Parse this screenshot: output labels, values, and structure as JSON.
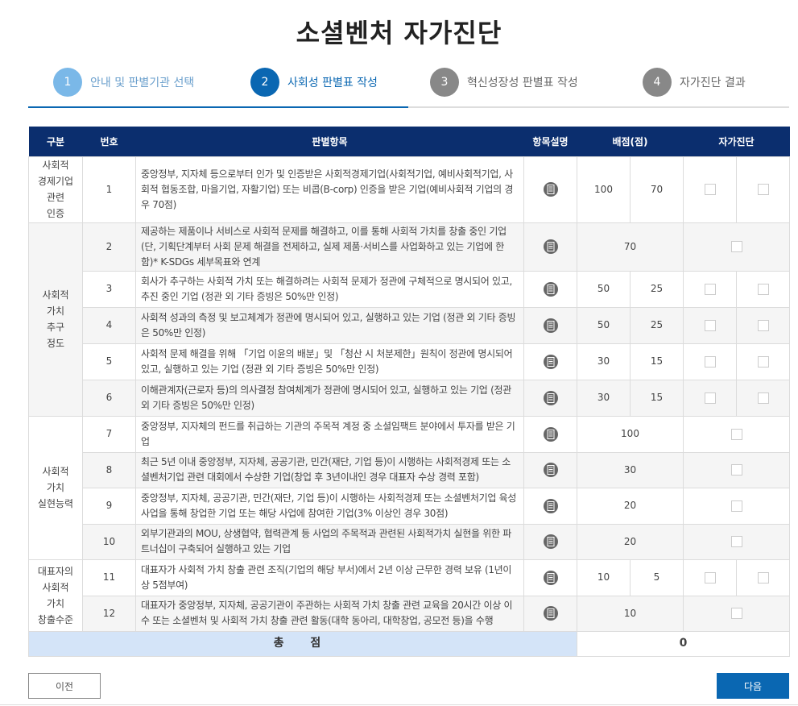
{
  "page": {
    "title": "소셜벤처 자가진단"
  },
  "steps": [
    {
      "num": "1",
      "label": "안내 및 판별기관 선택",
      "state": "done"
    },
    {
      "num": "2",
      "label": "사회성 판별표 작성",
      "state": "active"
    },
    {
      "num": "3",
      "label": "혁신성장성 판별표 작성",
      "state": "todo"
    },
    {
      "num": "4",
      "label": "자가진단 결과",
      "state": "todo"
    }
  ],
  "table": {
    "headers": {
      "category": "구분",
      "number": "번호",
      "item": "판별항목",
      "desc": "항목설명",
      "score": "배점(점)",
      "self": "자가진단"
    },
    "categories": {
      "c1": "사회적\n경제기업\n관련\n인증",
      "c2": "사회적\n가치\n추구\n정도",
      "c3": "사회적\n가치\n실현능력",
      "c4": "대표자의\n사회적\n가치\n창출수준"
    },
    "rows": [
      {
        "no": "1",
        "item": "중앙정부, 지자체 등으로부터 인가 및 인증받은 사회적경제기업(사회적기업, 예비사회적기업, 사회적 협동조합, 마을기업, 자활기업) 또는 비콥(B-corp) 인증을 받은 기업(예비사회적 기업의 경우 70점)",
        "s1": "100",
        "s2": "70"
      },
      {
        "no": "2",
        "item": "제공하는 제품이나 서비스로 사회적 문제를 해결하고, 이를 통해 사회적 가치를 창출 중인 기업(단, 기획단계부터 사회 문제 해결을 전제하고, 실제 제품·서비스를 사업화하고 있는 기업에 한함)* K-SDGs 세부목표와 연계",
        "s1": "70"
      },
      {
        "no": "3",
        "item": "회사가 추구하는 사회적 가치 또는 해결하려는 사회적 문제가 정관에 구체적으로 명시되어 있고, 추진 중인 기업 (정관 외 기타 증빙은 50%만 인정)",
        "s1": "50",
        "s2": "25"
      },
      {
        "no": "4",
        "item": "사회적 성과의 측정 및 보고체계가 정관에 명시되어 있고, 실행하고 있는 기업 (정관 외 기타 증빙은 50%만 인정)",
        "s1": "50",
        "s2": "25"
      },
      {
        "no": "5",
        "item": "사회적 문제 해결을 위해 「기업 이윤의 배분」및 「청산 시 처분제한」원칙이 정관에 명시되어 있고, 실행하고 있는 기업 (정관 외 기타 증빙은 50%만 인정)",
        "s1": "30",
        "s2": "15"
      },
      {
        "no": "6",
        "item": "이해관계자(근로자 등)의 의사결정 참여체계가 정관에 명시되어 있고, 실행하고 있는 기업 (정관 외 기타 증빙은 50%만 인정)",
        "s1": "30",
        "s2": "15"
      },
      {
        "no": "7",
        "item": "중앙정부, 지자체의 펀드를 취급하는 기관의 주목적 계정 중 소셜임팩트 분야에서 투자를 받은 기업",
        "s1": "100"
      },
      {
        "no": "8",
        "item": "최근 5년 이내 중앙정부, 지자체, 공공기관, 민간(재단, 기업 등)이 시행하는 사회적경제 또는 소셜벤처기업 관련 대회에서 수상한 기업(창업 후 3년이내인 경우 대표자 수상 경력 포함)",
        "s1": "30"
      },
      {
        "no": "9",
        "item": "중앙정부, 지자체, 공공기관, 민간(재단, 기업 등)이 시행하는 사회적경제 또는 소셜벤처기업 육성사업을 통해 창업한 기업 또는 해당 사업에 참여한 기업(3% 이상인 경우 30점)",
        "s1": "20"
      },
      {
        "no": "10",
        "item": "외부기관과의 MOU, 상생협약, 협력관계 등 사업의 주목적과 관련된 사회적가치 실현을 위한 파트너십이 구축되어 실행하고 있는 기업",
        "s1": "20"
      },
      {
        "no": "11",
        "item": "대표자가 사회적 가치 창출 관련 조직(기업의 해당 부서)에서 2년 이상 근무한 경력 보유 (1년이상 5점부여)",
        "s1": "10",
        "s2": "5"
      },
      {
        "no": "12",
        "item": "대표자가 중앙정부, 지자체, 공공기관이 주관하는 사회적 가치 창출 관련 교육을 20시간 이상 이수 또는 소셜벤처 및 사회적 가치 창출 관련 활동(대학 동아리, 대학창업, 공모전 등)을 수행",
        "s1": "10"
      }
    ],
    "total": {
      "label": "총 점",
      "value": "0"
    }
  },
  "buttons": {
    "prev": "이전",
    "next": "다음"
  },
  "colors": {
    "header_bg": "#0b2e6e",
    "accent": "#0a67b2",
    "total_bg": "#d4e4f8"
  }
}
